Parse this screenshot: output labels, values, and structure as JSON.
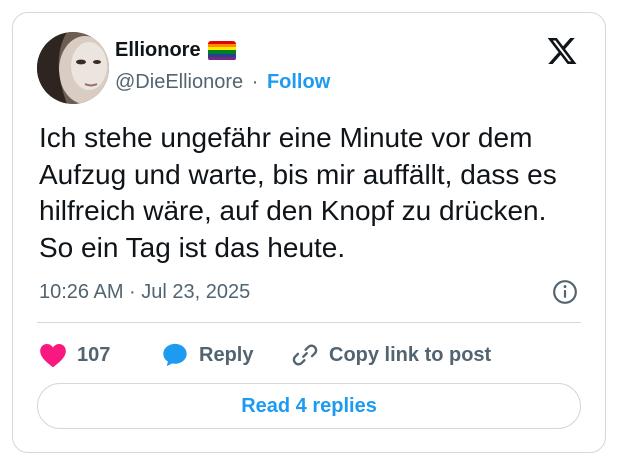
{
  "author": {
    "display_name": "Ellionore",
    "handle": "@DieEllionore",
    "separator": "·",
    "follow_label": "Follow",
    "flag_icon": "rainbow-flag-icon",
    "flag_colors": [
      "#e40303",
      "#ff8c00",
      "#ffed00",
      "#008026",
      "#24408e",
      "#732982"
    ]
  },
  "tweet": {
    "text": "Ich stehe ungefähr eine Minute vor dem Aufzug und warte, bis mir auffällt, dass es hilfreich wäre, auf den Knopf zu drücken. So ein Tag ist das heute.",
    "timestamp": "10:26 AM · Jul 23, 2025"
  },
  "actions": {
    "likes_count": "107",
    "reply_label": "Reply",
    "copy_label": "Copy link to post"
  },
  "replies_button": {
    "label": "Read 4 replies"
  },
  "colors": {
    "accent": "#1d9bf0",
    "like": "#f91880",
    "text": "#0f1419",
    "muted": "#536471",
    "border": "#cfd9de"
  },
  "icons": {
    "logo": "x-logo-icon",
    "info": "info-icon",
    "like": "heart-icon",
    "reply": "speech-bubble-icon",
    "copy": "link-icon"
  }
}
